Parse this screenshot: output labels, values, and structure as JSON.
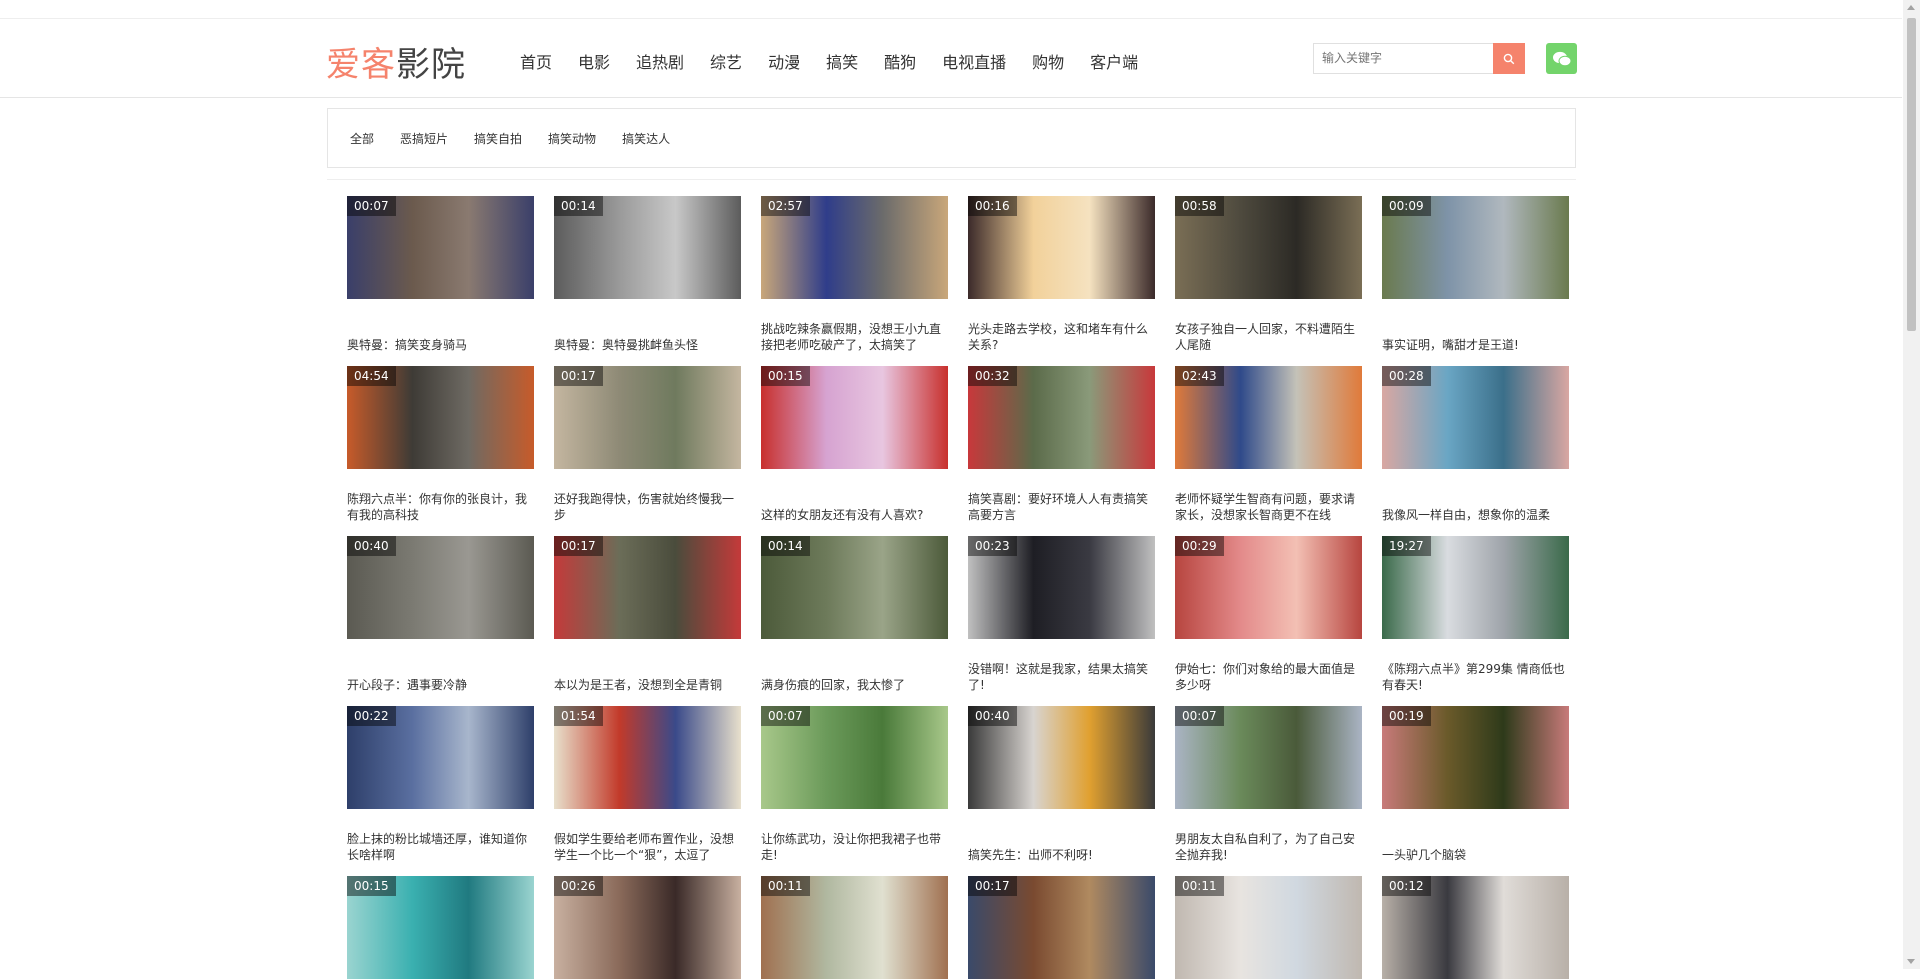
{
  "logo": {
    "part1": "爱客",
    "part2": "影院"
  },
  "nav": [
    "首页",
    "电影",
    "追热剧",
    "综艺",
    "动漫",
    "搞笑",
    "酷狗",
    "电视直播",
    "购物",
    "客户端"
  ],
  "search": {
    "placeholder": "输入关键字"
  },
  "icons": {
    "search_button": "search-icon",
    "wechat_button": "wechat-icon"
  },
  "colors": {
    "accent": "#f5836c",
    "wechat": "#73d46b"
  },
  "filters": [
    "全部",
    "恶搞短片",
    "搞笑自拍",
    "搞笑动物",
    "搞笑达人"
  ],
  "videos": [
    {
      "duration": "00:07",
      "title": "奥特曼：搞笑变身骑马"
    },
    {
      "duration": "00:14",
      "title": "奥特曼：奥特曼挑衅鱼头怪"
    },
    {
      "duration": "02:57",
      "title": "挑战吃辣条赢假期，没想王小九直接把老师吃破产了，太搞笑了"
    },
    {
      "duration": "00:16",
      "title": "光头走路去学校，这和堵车有什么关系?"
    },
    {
      "duration": "00:58",
      "title": "女孩子独自一人回家，不料遭陌生人尾随"
    },
    {
      "duration": "00:09",
      "title": "事实证明，嘴甜才是王道!"
    },
    {
      "duration": "04:54",
      "title": "陈翔六点半：你有你的张良计，我有我的高科技"
    },
    {
      "duration": "00:17",
      "title": "还好我跑得快，伤害就始终慢我一步"
    },
    {
      "duration": "00:15",
      "title": "这样的女朋友还有没有人喜欢?"
    },
    {
      "duration": "00:32",
      "title": "搞笑喜剧：要好环境人人有责搞笑高要方言"
    },
    {
      "duration": "02:43",
      "title": "老师怀疑学生智商有问题，要求请家长，没想家长智商更不在线"
    },
    {
      "duration": "00:28",
      "title": "我像风一样自由，想象你的温柔"
    },
    {
      "duration": "00:40",
      "title": "开心段子：遇事要冷静"
    },
    {
      "duration": "00:17",
      "title": "本以为是王者，没想到全是青铜"
    },
    {
      "duration": "00:14",
      "title": "满身伤痕的回家，我太惨了"
    },
    {
      "duration": "00:23",
      "title": "没错啊！这就是我家，结果太搞笑了!"
    },
    {
      "duration": "00:29",
      "title": "伊始七：你们对象给的最大面值是多少呀"
    },
    {
      "duration": "19:27",
      "title": "《陈翔六点半》第299集 情商低也有春天!"
    },
    {
      "duration": "00:22",
      "title": "脸上抹的粉比城墙还厚，谁知道你长啥样啊"
    },
    {
      "duration": "01:54",
      "title": "假如学生要给老师布置作业，没想学生一个比一个“狠”，太逗了"
    },
    {
      "duration": "00:07",
      "title": "让你练武功，没让你把我裙子也带走!"
    },
    {
      "duration": "00:40",
      "title": "搞笑先生：出师不利呀!"
    },
    {
      "duration": "00:07",
      "title": "男朋友太自私自利了，为了自己安全抛弃我!"
    },
    {
      "duration": "00:19",
      "title": "一头驴几个脑袋"
    },
    {
      "duration": "00:15",
      "title": ""
    },
    {
      "duration": "00:26",
      "title": ""
    },
    {
      "duration": "00:11",
      "title": ""
    },
    {
      "duration": "00:17",
      "title": ""
    },
    {
      "duration": "00:11",
      "title": ""
    },
    {
      "duration": "00:12",
      "title": ""
    }
  ]
}
